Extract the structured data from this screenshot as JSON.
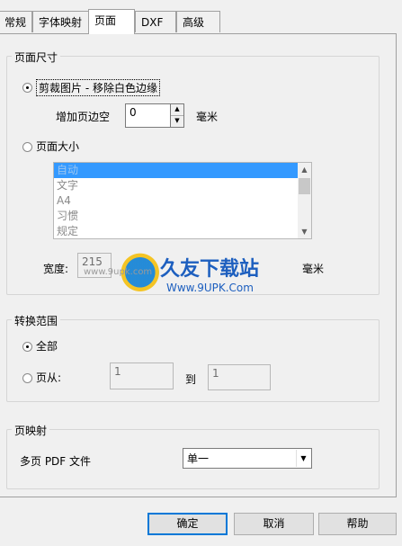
{
  "tabs": [
    {
      "label": "常规"
    },
    {
      "label": "字体映射"
    },
    {
      "label": "页面"
    },
    {
      "label": "DXF"
    },
    {
      "label": "高级"
    }
  ],
  "active_tab": "页面",
  "page_size_group": {
    "title": "页面尺寸",
    "crop_radio_label": "剪裁图片 - 移除白色边缘",
    "margin_label": "增加页边空",
    "margin_value": "0",
    "margin_unit": "毫米",
    "page_size_radio_label": "页面大小",
    "size_list": [
      "自动",
      "文字",
      "A4",
      "习惯",
      "规定"
    ],
    "selected_size": "自动",
    "width_label": "宽度:",
    "width_value": "215",
    "unit_right": "毫米"
  },
  "range_group": {
    "title": "转换范围",
    "all_label": "全部",
    "pages_from_label": "页从:",
    "from_value": "1",
    "to_label": "到",
    "to_value": "1"
  },
  "mapping_group": {
    "title": "页映射",
    "multi_page_label": "多页 PDF 文件",
    "selected_option": "单一"
  },
  "buttons": {
    "ok": "确定",
    "cancel": "取消",
    "help": "帮助"
  },
  "watermark": {
    "brand": "久友下载站",
    "url": "Www.9UPK.Com",
    "small_url": "www.9upk.com"
  }
}
